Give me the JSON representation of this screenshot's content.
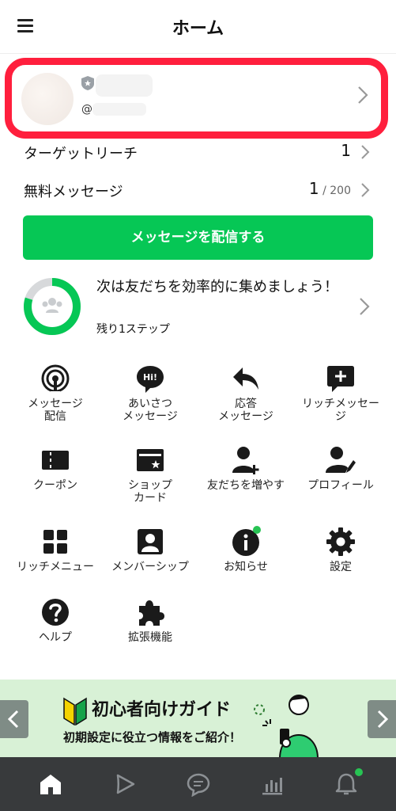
{
  "header": {
    "title": "ホーム"
  },
  "account": {
    "id_prefix": "@"
  },
  "stats": [
    {
      "label": "ターゲットリーチ",
      "value": "1",
      "sub": ""
    },
    {
      "label": "無料メッセージ",
      "value": "1",
      "sub": " / 200"
    }
  ],
  "send_button": "メッセージを配信する",
  "progress": {
    "message": "次は友だちを効率的に集めましょう！",
    "step": "残り1ステップ",
    "fraction": 0.8,
    "color": "#06c755"
  },
  "tiles": [
    {
      "label": "メッセージ\n配信",
      "icon": "broadcast-icon"
    },
    {
      "label": "あいさつ\nメッセージ",
      "icon": "greeting-icon"
    },
    {
      "label": "応答\nメッセージ",
      "icon": "reply-icon"
    },
    {
      "label": "リッチメッセー\nジ",
      "icon": "rich-message-icon"
    },
    {
      "label": "クーポン",
      "icon": "coupon-icon"
    },
    {
      "label": "ショップ\nカード",
      "icon": "shop-card-icon"
    },
    {
      "label": "友だちを増やす",
      "icon": "add-friend-icon"
    },
    {
      "label": "プロフィール",
      "icon": "profile-edit-icon"
    },
    {
      "label": "リッチメニュー",
      "icon": "rich-menu-icon"
    },
    {
      "label": "メンバーシップ",
      "icon": "membership-icon"
    },
    {
      "label": "お知らせ",
      "icon": "info-icon"
    },
    {
      "label": "設定",
      "icon": "gear-icon"
    },
    {
      "label": "ヘルプ",
      "icon": "help-icon"
    },
    {
      "label": "拡張機能",
      "icon": "puzzle-icon"
    }
  ],
  "banner": {
    "title": "初心者向けガイド",
    "subtitle": "初期設定に役立つ情報をご紹介！"
  },
  "tabbar": [
    {
      "icon": "home-icon"
    },
    {
      "icon": "play-icon"
    },
    {
      "icon": "chat-icon"
    },
    {
      "icon": "analytics-icon"
    },
    {
      "icon": "bell-icon"
    }
  ],
  "colors": {
    "accent": "#06c755",
    "highlight": "#ff1f3d",
    "tabbar": "#383a3c"
  }
}
